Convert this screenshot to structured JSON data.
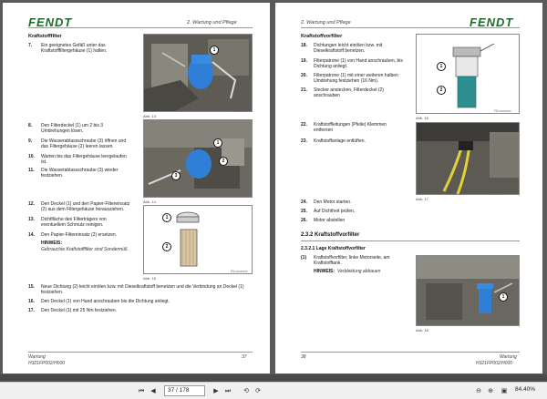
{
  "brand": {
    "logo_text": "FENDT",
    "color": "#1d6b2a"
  },
  "left_page": {
    "header_title": "2. Wartung und Pflege",
    "section_title": "Kraftstofffilter",
    "steps": [
      {
        "num": "7.",
        "text": "Ein geeignetes Gefäß unter das Kraftstofffiltergehäuse (1) halten."
      },
      {
        "num": "8.",
        "text": "Den Filterdeckel (1) um 2 bis 3 Umdrehungen lösen."
      },
      {
        "num": "9.",
        "text": "Die Wasserablassschraube (3) öffnen und das Filtergehäuse (2) leeren lassen."
      },
      {
        "num": "10.",
        "text": "Warten bis das Filtergehäuse leergelaufen ist."
      },
      {
        "num": "11.",
        "text": "Die Wasserablassschraube (3) wieder festziehen."
      },
      {
        "num": "12.",
        "text": "Den Deckel (1) und den Papier-Filtereinsatz (2) aus dem Filtergehäuse herausziehen."
      },
      {
        "num": "13.",
        "text": "Dichtfläche des Filterträgers von eventuellem Schmutz reinigen."
      },
      {
        "num": "14.",
        "text": "Den Papier-Filtereinsatz (2) ersetzen."
      },
      {
        "num": "15.",
        "text": "Neue Dichtung (2) leicht einölen bzw. mit Dieselkraftstoff benetzen und die Verbindung an Deckel (1) festziehen."
      },
      {
        "num": "16.",
        "text": "Den Deckel (1) von Hand anschrauben bis die Dichtung anliegt."
      },
      {
        "num": "17.",
        "text": "Den Deckel (1) mit 25 Nm festziehen."
      }
    ],
    "note_heading": "HINWEIS:",
    "note_text": "Gebrauchte Kraftstofffilter sind Sondermüll.",
    "figures": [
      {
        "caption": "Abb. 13",
        "code": "FAI-xxxxxxxx"
      },
      {
        "caption": "Abb. 14",
        "code": "FAI-xxxxxxxx"
      },
      {
        "caption": "Abb. 15",
        "code": "FAI-xxxxxxxx"
      }
    ],
    "footer_left": "Wartung",
    "footer_left2": "H321FP002/H000",
    "footer_page": "37"
  },
  "right_page": {
    "header_title": "2. Wartung und Pflege",
    "section_title": "Kraftstoffvorfilter",
    "steps_a": [
      {
        "num": "18.",
        "text": "Dichtungen leicht einölen bzw. mit Dieselkraftstoff benetzen."
      },
      {
        "num": "19.",
        "text": "Filterpatrone (1) von Hand anschrauben, bis Dichtung anliegt."
      },
      {
        "num": "20.",
        "text": "Filterpatrone (1) mit einer weiteren halben Umdrehung festziehen (16 Nm)."
      },
      {
        "num": "21.",
        "text": "Stecker anstecken, Filterdeckel (2) anschrauben"
      },
      {
        "num": "22.",
        "text": "Kraftstoffleitungen (Pfeile) Klemmen entfernen"
      },
      {
        "num": "23.",
        "text": "Kraftstoffanlage entlüften."
      },
      {
        "num": "24.",
        "text": "Den Motor starten."
      },
      {
        "num": "25.",
        "text": "Auf Dichtheit prüfen."
      },
      {
        "num": "26.",
        "text": "Motor abstellen"
      }
    ],
    "subsection_title": "2.3.2  Kraftstoffvorfilter",
    "subsub_title": "2.3.2.1  Lage Kraftstoffvorfilter",
    "item1_num": "(1)",
    "item1_text": "Kraftstoffvorfilter, linke Motorseite, am Kraftstofftank.",
    "note_heading": "HINWEIS:",
    "note_text": "Verbleidung abbauen",
    "figures": [
      {
        "caption": "Abb. 16",
        "code": "FAI-xxxxxxxx"
      },
      {
        "caption": "Abb. 17",
        "code": "FAI-xxxxxxxx"
      },
      {
        "caption": "Abb. 18",
        "code": "FAI-xxxxxxxx"
      }
    ],
    "footer_left": "Wartung",
    "footer_left2": "H321FP002/H000",
    "footer_page": "38"
  },
  "toolbar": {
    "page_value": "37 / 178",
    "zoom_value": "84.40%",
    "icons": [
      "first-page-icon",
      "prev-page-icon",
      "next-page-icon",
      "last-page-icon",
      "back-icon",
      "forward-icon",
      "zoom-icon"
    ]
  },
  "callouts": {
    "one": "1",
    "two": "2",
    "three": "3"
  }
}
